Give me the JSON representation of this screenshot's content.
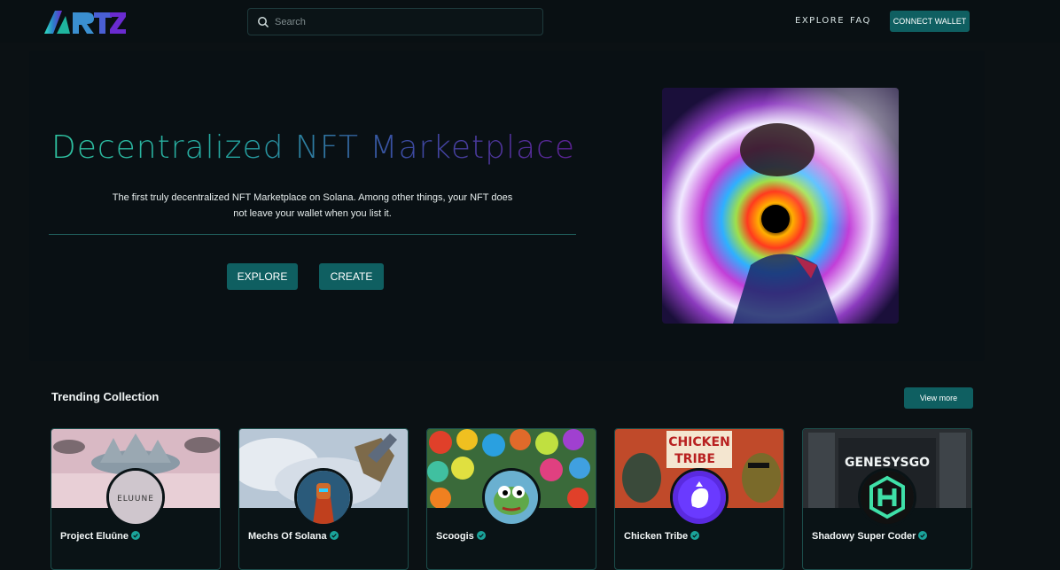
{
  "header": {
    "logo_text": "ARTZ",
    "search_placeholder": "Search",
    "nav": [
      "EXPLORE",
      "FAQ"
    ],
    "connect_wallet": "CONNECT WALLET"
  },
  "hero": {
    "title": "Decentralized NFT Marketplace",
    "subtitle": "The first truly decentralized NFT Marketplace on Solana. Among other things, your NFT does not leave your wallet when you list it.",
    "explore_button": "EXPLORE",
    "create_button": "CREATE"
  },
  "trending": {
    "title": "Trending Collection",
    "view_more": "View more",
    "collections": [
      {
        "name": "Project Eluūne",
        "verified": true
      },
      {
        "name": "Mechs Of Solana",
        "verified": true
      },
      {
        "name": "Scoogis",
        "verified": true
      },
      {
        "name": "Chicken Tribe",
        "verified": true
      },
      {
        "name": "Shadowy Super Coder",
        "verified": true
      }
    ]
  },
  "colors": {
    "accent": "#0f5f61",
    "background": "#0b1114",
    "verified": "#1aa39a"
  }
}
